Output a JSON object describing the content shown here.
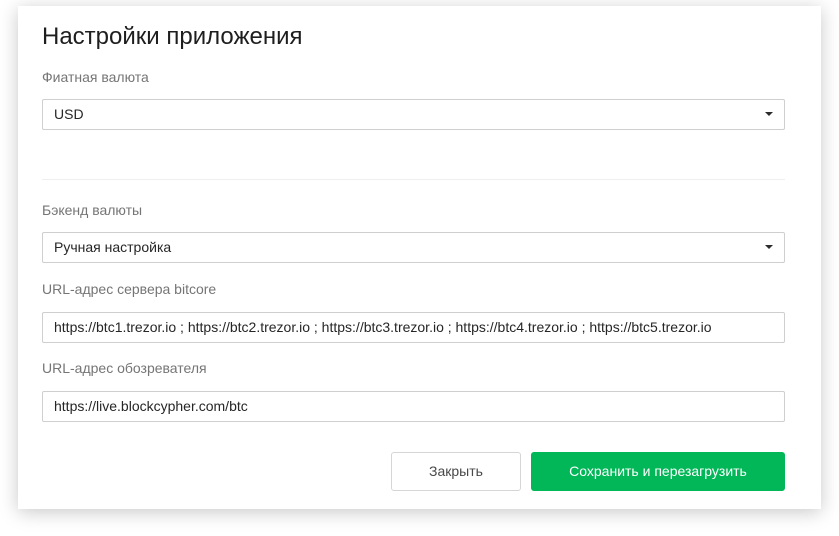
{
  "dialog": {
    "title": "Настройки приложения"
  },
  "fiat": {
    "label": "Фиатная валюта",
    "value": "USD"
  },
  "backend": {
    "label": "Бэкенд валюты",
    "value": "Ручная настройка"
  },
  "bitcore": {
    "label": "URL-адрес сервера bitcore",
    "value": "https://btc1.trezor.io ; https://btc2.trezor.io ; https://btc3.trezor.io ; https://btc4.trezor.io ; https://btc5.trezor.io"
  },
  "explorer": {
    "label": "URL-адрес обозревателя",
    "value": "https://live.blockcypher.com/btc"
  },
  "buttons": {
    "close_label": "Закрыть",
    "save_label": "Сохранить и перезагрузить"
  },
  "colors": {
    "accent": "#01b757",
    "text": "#1e1e1e",
    "label": "#757575",
    "border": "#cfcfcf"
  },
  "icons": {
    "select_caret": "caret-down-icon"
  }
}
